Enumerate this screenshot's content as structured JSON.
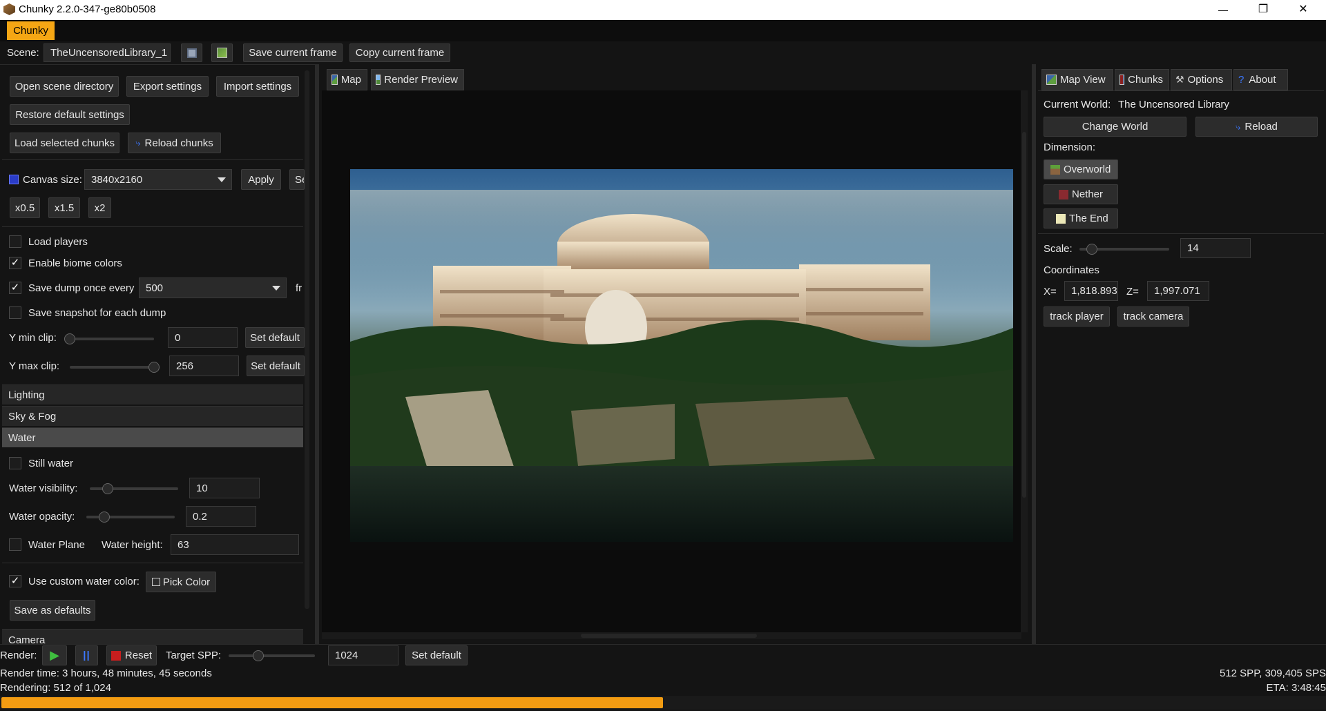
{
  "window": {
    "title": "Chunky 2.2.0-347-ge80b0508",
    "minimize_glyph": "—",
    "restore_glyph": "❐",
    "close_glyph": "✕"
  },
  "menu": {
    "chunky": "Chunky"
  },
  "toolbar": {
    "scene_label": "Scene:",
    "scene_name": "TheUncensoredLibrary_1",
    "save_current_frame": "Save current frame",
    "copy_current_frame": "Copy current frame"
  },
  "left": {
    "open_scene_directory": "Open scene directory",
    "export_settings": "Export settings",
    "import_settings": "Import settings",
    "restore_default_settings": "Restore default settings",
    "load_selected_chunks": "Load selected chunks",
    "reload_chunks": "Reload chunks",
    "canvas_size_label": "Canvas size:",
    "canvas_size_value": "3840x2160",
    "apply": "Apply",
    "cut_button": "Se",
    "x05": "x0.5",
    "x15": "x1.5",
    "x2": "x2",
    "load_players": "Load players",
    "enable_biome_colors": "Enable biome colors",
    "save_dump_once_every": "Save dump once every",
    "dump_value": "500",
    "dump_unit_cut": "fr",
    "save_snapshot": "Save snapshot for each dump",
    "ymin_label": "Y min clip:",
    "ymin_value": "0",
    "ymax_label": "Y max clip:",
    "ymax_value": "256",
    "set_default": "Set default",
    "sections": {
      "lighting": "Lighting",
      "sky_fog": "Sky & Fog",
      "water": "Water",
      "camera": "Camera"
    },
    "still_water": "Still water",
    "water_visibility_label": "Water visibility:",
    "water_visibility_value": "10",
    "water_opacity_label": "Water opacity:",
    "water_opacity_value": "0.2",
    "water_plane": "Water Plane",
    "water_height_label": "Water height:",
    "water_height_value": "63",
    "use_custom_water_color": "Use custom water color:",
    "pick_color": "Pick Color",
    "save_as_defaults": "Save as defaults",
    "checkmark": "✓"
  },
  "center": {
    "tab_map": "Map",
    "tab_render_preview": "Render Preview"
  },
  "right": {
    "tabs": {
      "map_view": "Map View",
      "chunks": "Chunks",
      "options": "Options",
      "about": "About",
      "about_glyph": "?",
      "options_glyph": "⚒"
    },
    "current_world_label": "Current World:",
    "current_world_value": "The Uncensored Library",
    "change_world": "Change World",
    "reload": "Reload",
    "dimension_label": "Dimension:",
    "overworld": "Overworld",
    "nether": "Nether",
    "the_end": "The End",
    "scale_label": "Scale:",
    "scale_value": "14",
    "coordinates_label": "Coordinates",
    "x_label": "X=",
    "x_value": "1,818.893",
    "z_label": "Z=",
    "z_value": "1,997.071",
    "track_player": "track player",
    "track_camera": "track camera"
  },
  "bottom": {
    "render_label": "Render:",
    "play_glyph": "▶",
    "pause_glyph": "||",
    "reset": "Reset",
    "target_spp_label": "Target SPP:",
    "target_spp_value": "1024",
    "set_default": "Set default",
    "render_time": "Render time: 3 hours, 48 minutes, 45 seconds",
    "rendering_progress": "Rendering: 512 of 1,024",
    "spp_sps": "512 SPP, 309,405 SPS",
    "eta": "ETA: 3:48:45",
    "progress_fraction": 0.5
  },
  "colors": {
    "accent": "#f5a614",
    "progress": "#f39c12",
    "play_green": "#3fbf3f",
    "reset_red": "#c81e1e",
    "reload_blue": "#3c78ff"
  }
}
